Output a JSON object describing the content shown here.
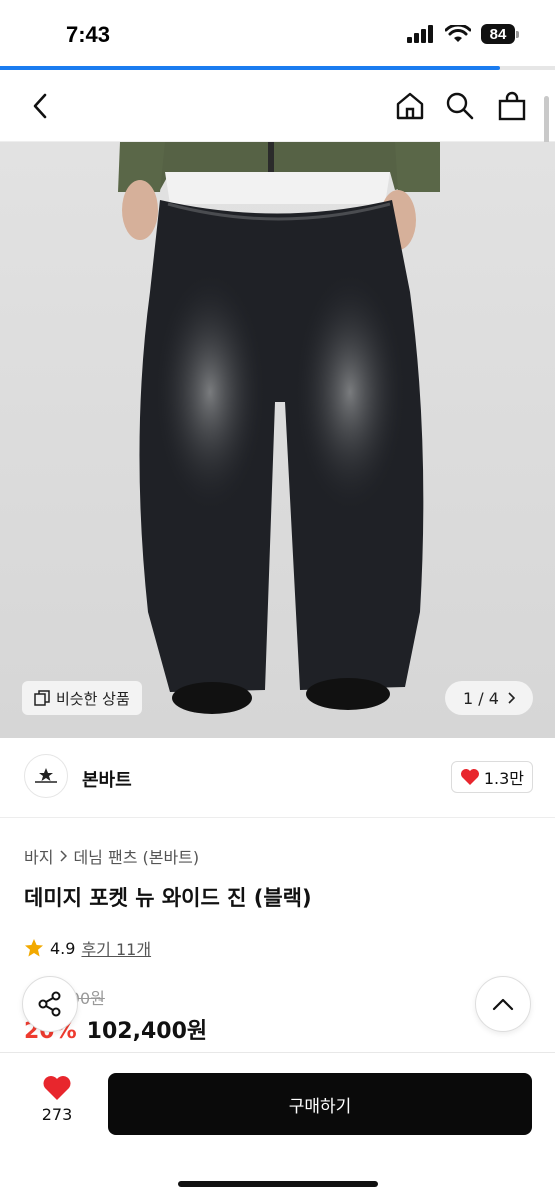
{
  "status_bar": {
    "time": "7:43",
    "battery": "84"
  },
  "load_progress": 0.9,
  "product_image": {
    "pager": "1 / 4",
    "similar_label": "비슷한 상품"
  },
  "brand": {
    "name": "본바트",
    "likes": "1.3만"
  },
  "breadcrumb": {
    "category": "바지",
    "subcategory": "데님 팬츠 (본바트)"
  },
  "product": {
    "title": "데미지 포켓 뉴 와이드 진 (블랙)",
    "rating": "4.9",
    "reviews": "후기 11개",
    "original_price": "128,000원",
    "discount": "20%",
    "price": "102,400원"
  },
  "bottom_bar": {
    "wish_count": "273",
    "buy_label": "구매하기"
  },
  "colors": {
    "accent": "#1a7cf0",
    "discount": "#ee3b2f",
    "heart": "#e8262d",
    "buy": "#0a0a0a"
  }
}
